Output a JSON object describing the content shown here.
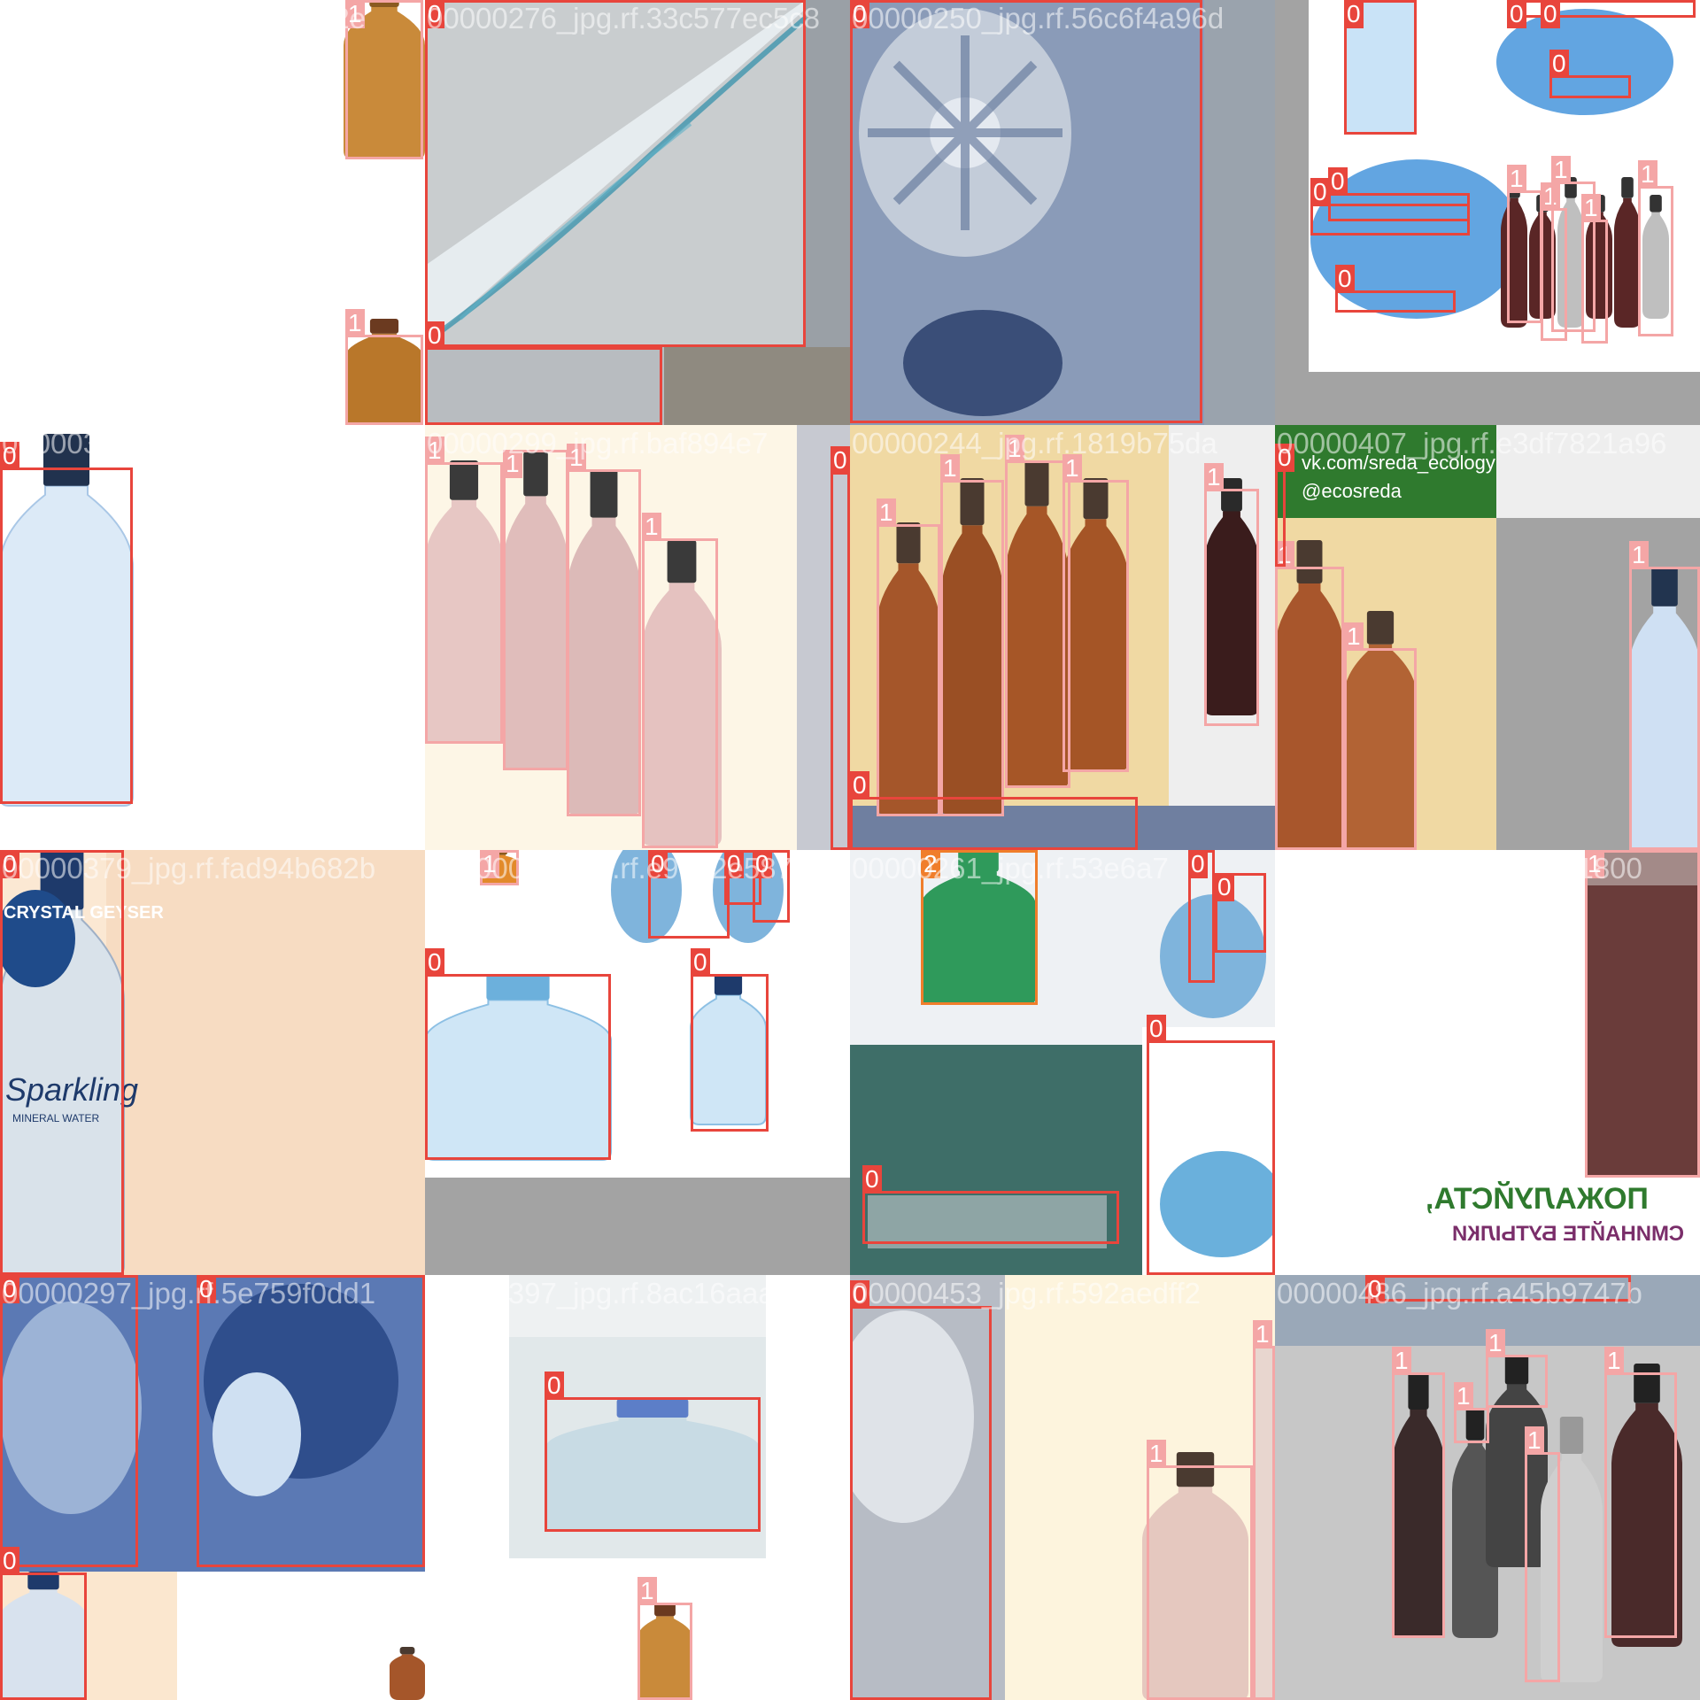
{
  "colors": {
    "class_0": "#e8453c",
    "class_1": "#f4a6a6",
    "class_2": "#f07e2b",
    "label_text": "#ffffff",
    "pad_gray": "#a3a3a3"
  },
  "tiles": [
    {
      "title": "00000320_jpg.rf.b69c2122e",
      "labels": [
        "1",
        "1"
      ]
    },
    {
      "title": "00000276_jpg.rf.33c577ec5c8",
      "labels": [
        "0",
        "0",
        "0"
      ]
    },
    {
      "title": "00000250_jpg.rf.56c6f4a96d",
      "labels": [
        "0"
      ]
    },
    {
      "title": "",
      "labels": [
        "0",
        "0",
        "0",
        "0",
        "0",
        "0",
        "0",
        "1",
        "1",
        "1",
        "1",
        "1"
      ]
    },
    {
      "title": "00000386_jpg.rf.4f96fa719e",
      "labels": [
        "0"
      ]
    },
    {
      "title": "00000299_jpg.rf.baf894e7",
      "labels": [
        "1",
        "1",
        "1",
        "1",
        "0"
      ]
    },
    {
      "title": "00000244_jpg.rf.1819b75da",
      "labels": [
        "1",
        "1",
        "1",
        "1",
        "1",
        "0"
      ]
    },
    {
      "title": "00000407_jpg.rf.e3df7821a96",
      "labels": [
        "1",
        "1",
        "1",
        "0"
      ]
    },
    {
      "title": "00000379_jpg.rf.fad94b682b",
      "labels": [
        "0"
      ]
    },
    {
      "title": "00000027_jpg.rf.e9072e587",
      "labels": [
        "1",
        "0",
        "0",
        "0",
        "0",
        "0"
      ]
    },
    {
      "title": "00000261_jpg.rf.53e6a7",
      "labels": [
        "2",
        "0",
        "0",
        "0",
        "0"
      ]
    },
    {
      "title": "00000284_jpg.rf.806241800",
      "labels": [
        "1"
      ]
    },
    {
      "title": "00000297_jpg.rf.5e759f0dd1",
      "labels": [
        "0",
        "0",
        "0"
      ]
    },
    {
      "title": "00000397_jpg.rf.8ac16aaab",
      "labels": [
        "0",
        "1"
      ]
    },
    {
      "title": "00000453_jpg.rf.592aedff2",
      "labels": [
        "0",
        "1",
        "1"
      ]
    },
    {
      "title": "00000486_jpg.rf.a45b9747b",
      "labels": [
        "0",
        "1",
        "1",
        "1",
        "1",
        "1"
      ]
    }
  ],
  "overlay_text": {
    "social_vk": "vk.com/sreda_ecology",
    "social_handle": "@ecosreda",
    "poster_line1": "ПОЖАЛУЙСТА,",
    "poster_line2": "СМИНАЙТЕ БУТЫЛКИ",
    "brand_crystal": "CRYSTAL GEYSER",
    "brand_sparkling": "Sparkling",
    "brand_mineral": "MINERAL WATER"
  }
}
